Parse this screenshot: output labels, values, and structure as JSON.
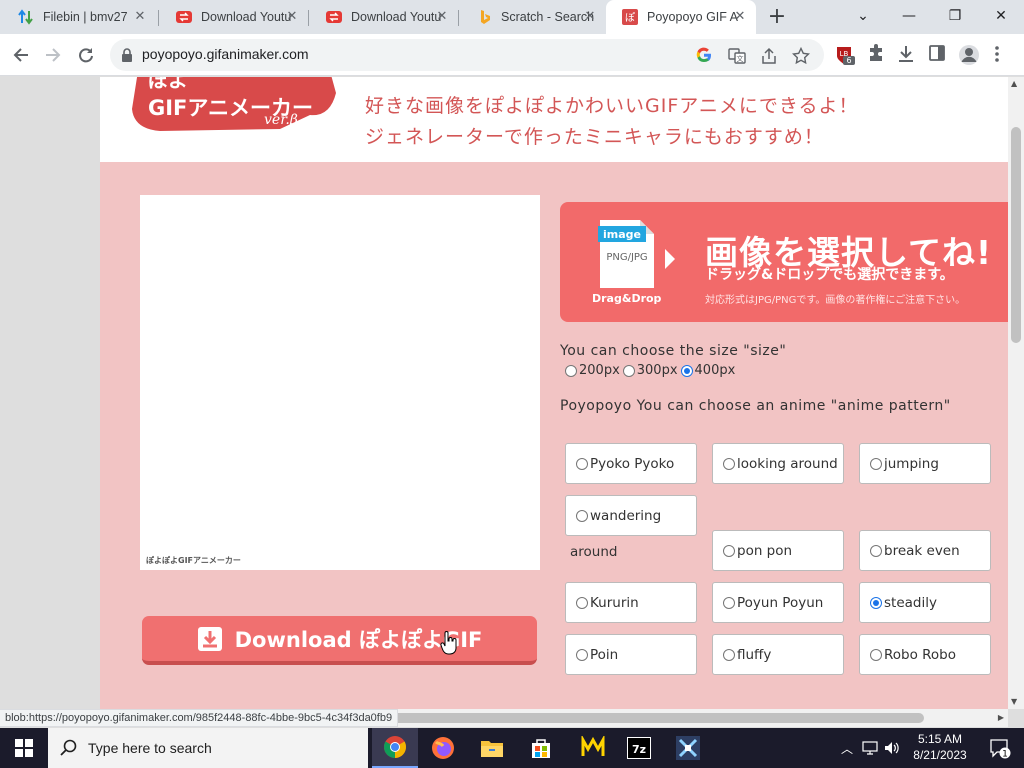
{
  "browser": {
    "tabs": [
      {
        "title": "Filebin | bmv27",
        "icon": "filebin-icon"
      },
      {
        "title": "Download Youtu",
        "icon": "youtube-downloader-icon"
      },
      {
        "title": "Download Youtu",
        "icon": "youtube-downloader-icon"
      },
      {
        "title": "Scratch - Search",
        "icon": "bing-icon"
      },
      {
        "title": "Poyopoyo GIF A",
        "icon": "poyopoyo-icon"
      }
    ],
    "active_tab": 4,
    "url": "poyopoyo.gifanimaker.com",
    "extension_badge": "6",
    "status_url": "blob:https://poyopoyo.gifanimaker.com/985f2448-88fc-4bbe-9bc5-4c34f3da0fb9"
  },
  "site": {
    "logo_text": "ぽよGIFアニメーカー ver.β",
    "tagline_line1": "好きな画像をぽよぽよかわいいGIFアニメにできるよ！",
    "tagline_line2": "ジェネレーターで作ったミニキャラにもおすすめ！",
    "preview_caption": "ぽよぽよGIFアニメーカー",
    "download_button": "Download ぽよぽよGIF",
    "select": {
      "file_badge": "image",
      "file_types": "PNG/JPG",
      "drag_drop": "Drag&Drop",
      "heading": "画像を選択してね!",
      "subheading": "ドラッグ&ドロップでも選択できます。",
      "note": "対応形式はJPG/PNGです。画像の著作権にご注意下さい。"
    },
    "size_label": "You can choose the size \"size\"",
    "sizes": [
      {
        "label": "200px",
        "checked": false
      },
      {
        "label": "300px",
        "checked": false
      },
      {
        "label": "400px",
        "checked": true
      }
    ],
    "pattern_label": "Poyopoyo You can choose an anime \"anime pattern\"",
    "patterns": [
      {
        "label": "Pyoko Pyoko",
        "checked": false
      },
      {
        "label": "looking around",
        "checked": false
      },
      {
        "label": "jumping",
        "checked": false
      },
      {
        "label": "wandering",
        "checked": false
      },
      {
        "label": "pon pon",
        "checked": false
      },
      {
        "label": "break even",
        "checked": false
      },
      {
        "label": "Kururin",
        "checked": false
      },
      {
        "label": "Poyun Poyun",
        "checked": false
      },
      {
        "label": "steadily",
        "checked": true
      },
      {
        "label": "Poin",
        "checked": false
      },
      {
        "label": "fluffy",
        "checked": false
      },
      {
        "label": "Robo Robo",
        "checked": false
      }
    ],
    "wandering_overflow": "around"
  },
  "taskbar": {
    "search_placeholder": "Type here to search",
    "time": "5:15 AM",
    "date": "8/21/2023",
    "notification_count": "1",
    "apps": [
      "chrome-icon",
      "firefox-icon",
      "file-explorer-icon",
      "store-icon",
      "app-m-icon",
      "7zip-icon",
      "app-tool-icon"
    ]
  },
  "colors": {
    "site_bg": "#f2c4c4",
    "accent": "#f07070",
    "tagline": "#d35656"
  }
}
